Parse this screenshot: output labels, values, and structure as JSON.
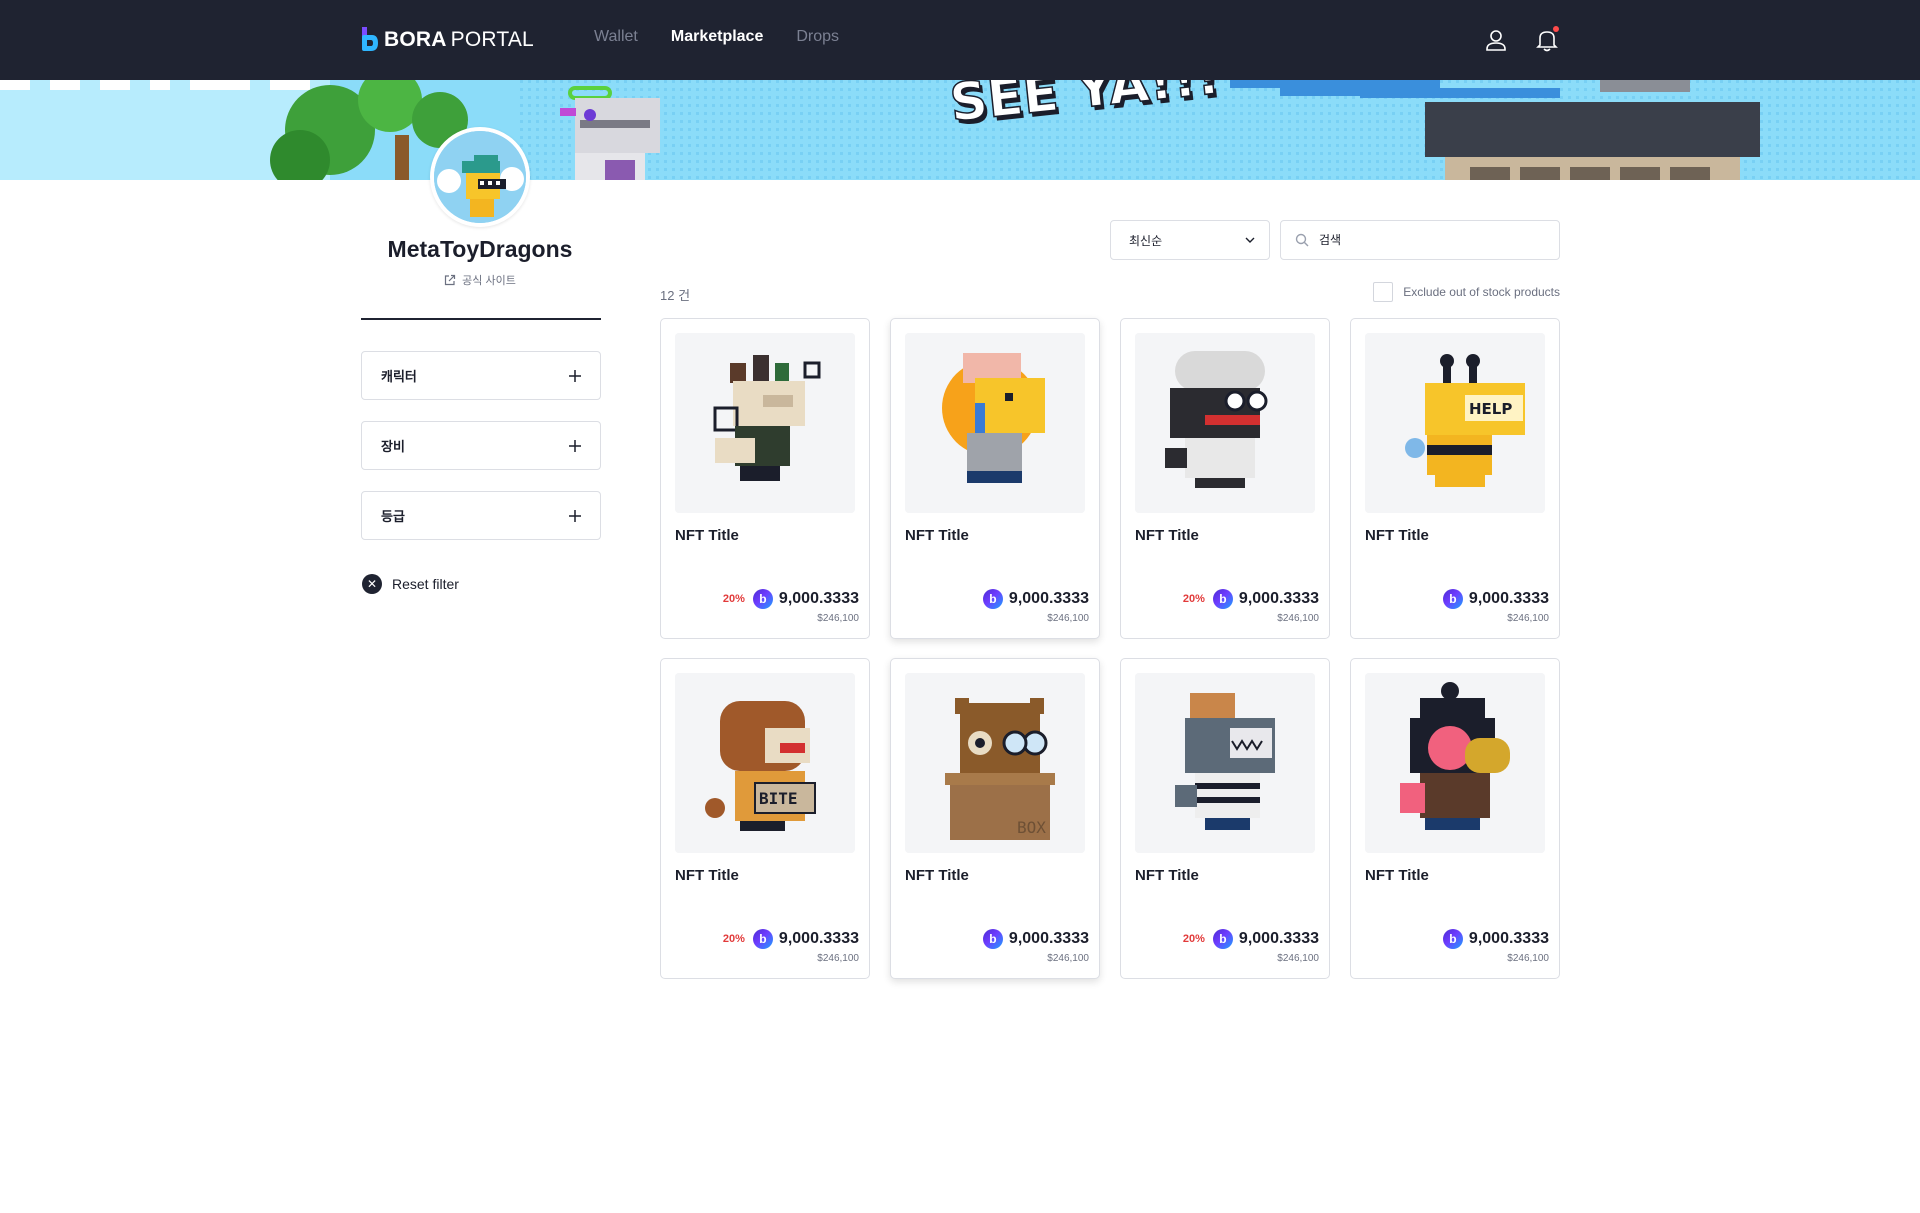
{
  "header": {
    "logo_bold": "BORA",
    "logo_light": "PORTAL",
    "nav": [
      {
        "label": "Wallet",
        "active": false
      },
      {
        "label": "Marketplace",
        "active": true
      },
      {
        "label": "Drops",
        "active": false
      }
    ]
  },
  "banner": {
    "text": "SEE YA!!!"
  },
  "profile": {
    "name": "MetaToyDragons",
    "official_link": "공식 사이트"
  },
  "filters": [
    {
      "label": "캐릭터"
    },
    {
      "label": "장비"
    },
    {
      "label": "등급"
    }
  ],
  "reset_label": "Reset filter",
  "toolbar": {
    "sort_value": "최신순",
    "search_placeholder": "검색",
    "count": "12 건",
    "exclude_label": "Exclude out of stock products"
  },
  "cards": [
    {
      "title": "NFT Title",
      "discount": "20%",
      "price": "9,000.3333",
      "usd": "$246,100",
      "char": "bear"
    },
    {
      "title": "NFT Title",
      "discount": "",
      "price": "9,000.3333",
      "usd": "$246,100",
      "char": "lion"
    },
    {
      "title": "NFT Title",
      "discount": "20%",
      "price": "9,000.3333",
      "usd": "$246,100",
      "char": "chef"
    },
    {
      "title": "NFT Title",
      "discount": "",
      "price": "9,000.3333",
      "usd": "$246,100",
      "char": "bee"
    },
    {
      "title": "NFT Title",
      "discount": "20%",
      "price": "9,000.3333",
      "usd": "$246,100",
      "char": "dog"
    },
    {
      "title": "NFT Title",
      "discount": "",
      "price": "9,000.3333",
      "usd": "$246,100",
      "char": "owl"
    },
    {
      "title": "NFT Title",
      "discount": "20%",
      "price": "9,000.3333",
      "usd": "$246,100",
      "char": "shark"
    },
    {
      "title": "NFT Title",
      "discount": "",
      "price": "9,000.3333",
      "usd": "$246,100",
      "char": "pink"
    }
  ],
  "colors": {
    "header_bg": "#1f2331",
    "accent": "#6e3cff",
    "discount": "#e23a3a",
    "banner_sky": "#8bdcf9"
  }
}
